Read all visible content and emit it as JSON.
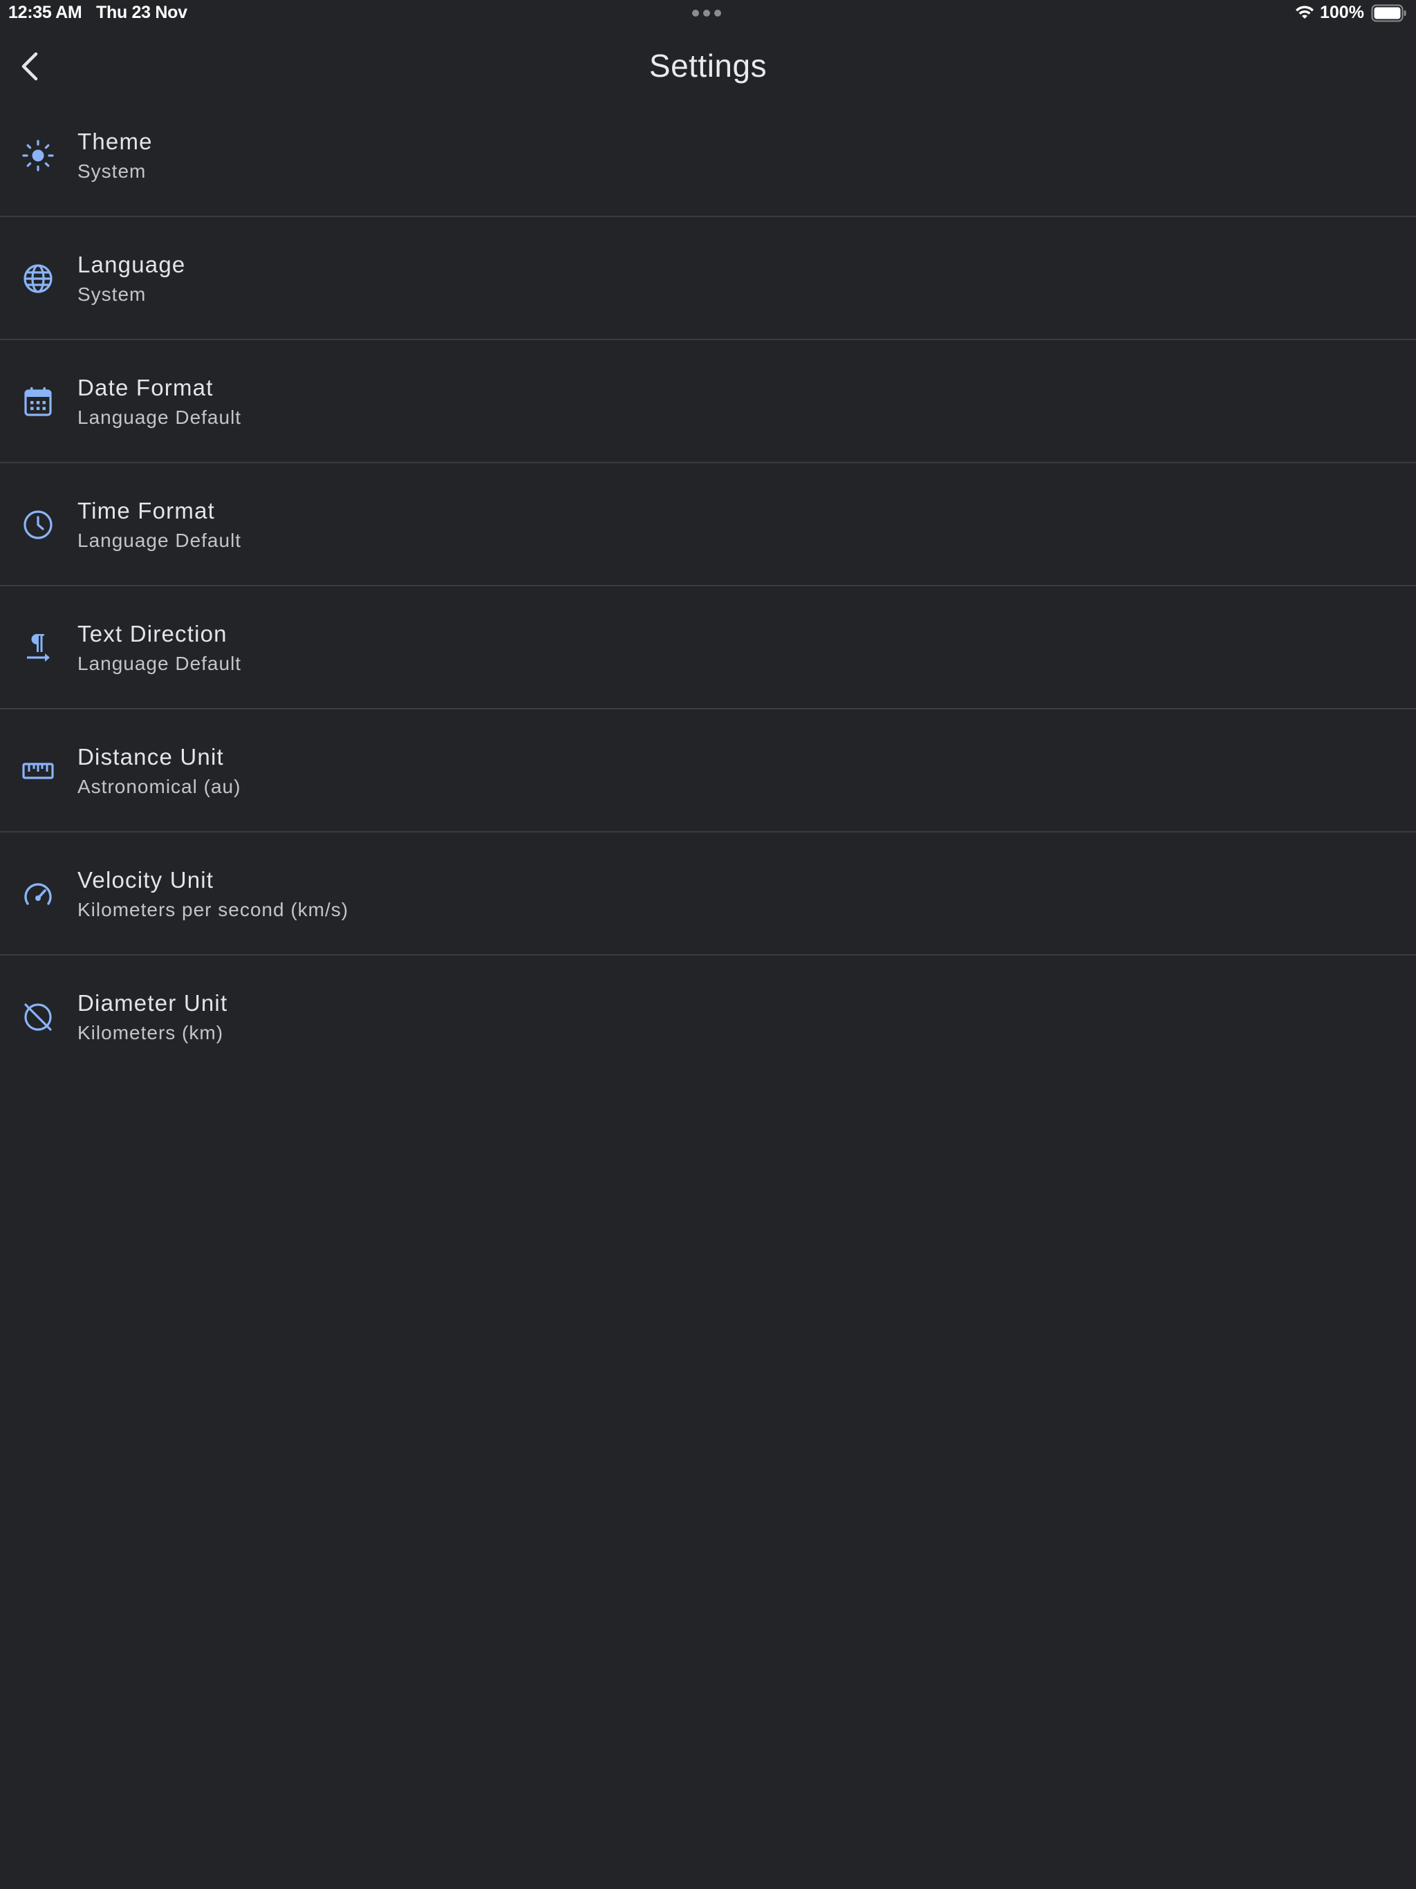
{
  "status_bar": {
    "time": "12:35 AM",
    "date": "Thu 23 Nov",
    "battery": "100%",
    "icons": [
      "wifi-icon",
      "battery-icon",
      "multitask-dots-icon"
    ]
  },
  "header": {
    "title": "Settings",
    "back_icon": "chevron-left-icon"
  },
  "colors": {
    "background": "#232428",
    "accent": "#8ab4f8",
    "divider": "#3b3c42"
  },
  "settings": [
    {
      "title": "Theme",
      "value": "System",
      "icon": "sun-icon"
    },
    {
      "title": "Language",
      "value": "System",
      "icon": "globe-icon"
    },
    {
      "title": "Date Format",
      "value": "Language Default",
      "icon": "calendar-icon"
    },
    {
      "title": "Time Format",
      "value": "Language Default",
      "icon": "clock-icon"
    },
    {
      "title": "Text Direction",
      "value": "Language Default",
      "icon": "text-direction-icon"
    },
    {
      "title": "Distance Unit",
      "value": "Astronomical (au)",
      "icon": "ruler-icon"
    },
    {
      "title": "Velocity Unit",
      "value": "Kilometers per second (km/s)",
      "icon": "speedometer-icon"
    },
    {
      "title": "Diameter Unit",
      "value": "Kilometers (km)",
      "icon": "diameter-icon"
    }
  ]
}
